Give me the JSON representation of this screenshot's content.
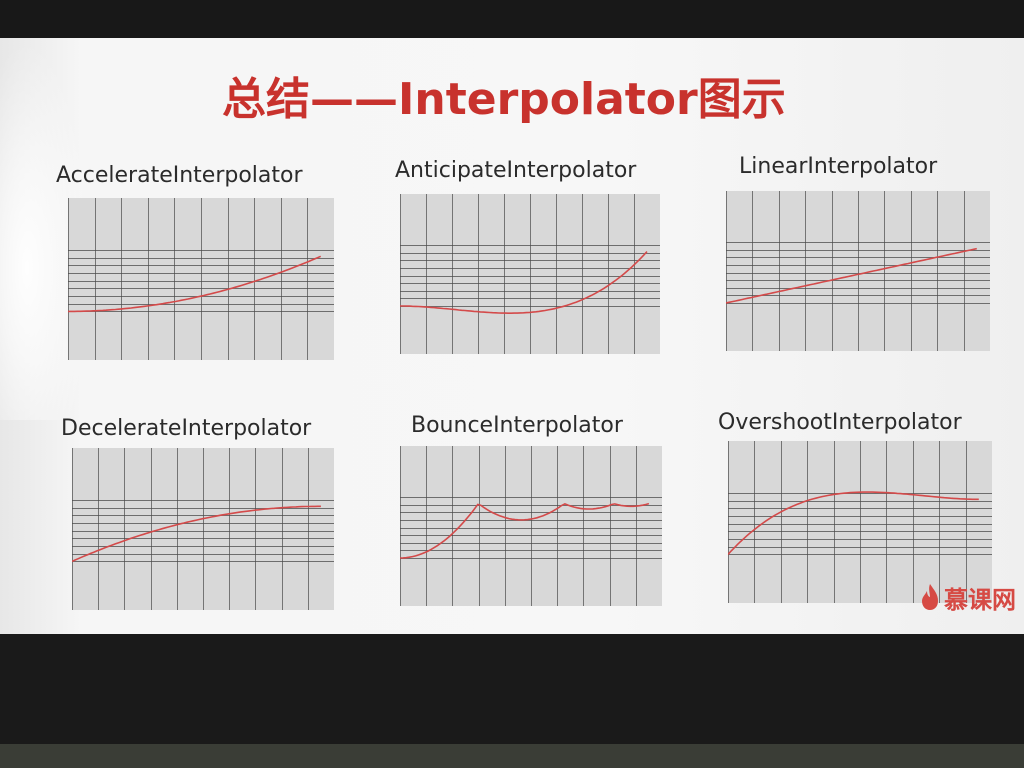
{
  "title": "总结——Interpolator图示",
  "watermark": "慕课网",
  "colors": {
    "title": "#c8322d",
    "curve": "#d44a4a",
    "grid": "#4a4a4a",
    "plot_bg": "#d8d8d8"
  },
  "panels": [
    {
      "label": "AccelerateInterpolator",
      "curve": "accelerate"
    },
    {
      "label": "AnticipateInterpolator",
      "curve": "anticipate"
    },
    {
      "label": "LinearInterpolator",
      "curve": "linear"
    },
    {
      "label": "DecelerateInterpolator",
      "curve": "decelerate"
    },
    {
      "label": "BounceInterpolator",
      "curve": "bounce"
    },
    {
      "label": "OvershootInterpolator",
      "curve": "overshoot"
    }
  ]
}
